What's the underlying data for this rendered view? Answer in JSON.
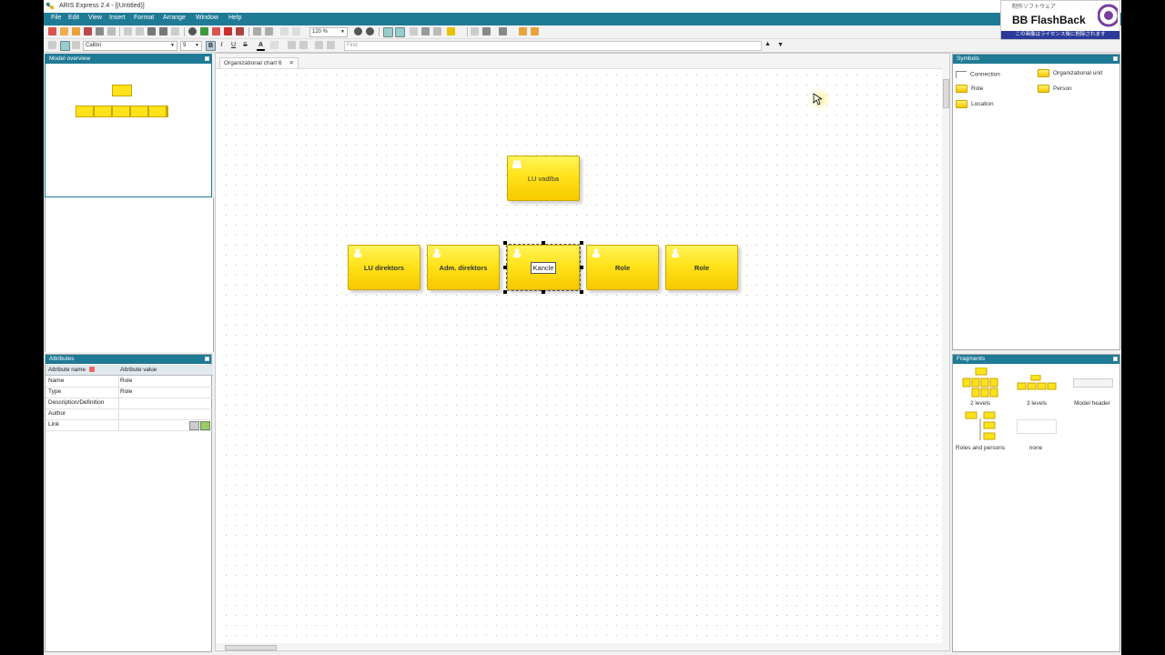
{
  "window": {
    "title": "ARIS Express 2.4 - [(Untitled)]"
  },
  "menu": [
    "File",
    "Edit",
    "View",
    "Insert",
    "Format",
    "Arrange",
    "Window",
    "Help"
  ],
  "toolbar": {
    "zoom": "120 %",
    "font": "Calibri",
    "font_size": "9",
    "find_placeholder": "Find"
  },
  "model_overview": {
    "title": "Model overview"
  },
  "document_tab": {
    "label": "Organizational chart 6"
  },
  "diagram": {
    "top_unit": "LU vadība",
    "roles": [
      "LU direktors",
      "Adm. direktors",
      "",
      "Role",
      "Role"
    ],
    "editing_text": "Kancle"
  },
  "attributes": {
    "title": "Attributes",
    "col_name": "Attribute name",
    "col_value": "Attribute value",
    "rows": [
      {
        "name": "Name",
        "value": "Role"
      },
      {
        "name": "Type",
        "value": "Role"
      },
      {
        "name": "Description/Definition",
        "value": ""
      },
      {
        "name": "Author",
        "value": ""
      },
      {
        "name": "Link",
        "value": ""
      }
    ]
  },
  "symbols": {
    "title": "Symbols",
    "items": [
      "Connection",
      "Organizational unit",
      "Role",
      "Person",
      "Location"
    ]
  },
  "fragments": {
    "title": "Fragments",
    "items": [
      "2 levels",
      "3 levels",
      "Model header",
      "Roles and persons",
      "none"
    ]
  },
  "watermark": {
    "jp_top": "制作ソフトウェア",
    "brand": "BB FlashBack",
    "jp_bottom": "この画像はライセンス後に削除されます"
  },
  "colors": {
    "accent": "#1f7a95",
    "box_fill": "#ffe31a",
    "box_border": "#c8a600"
  }
}
